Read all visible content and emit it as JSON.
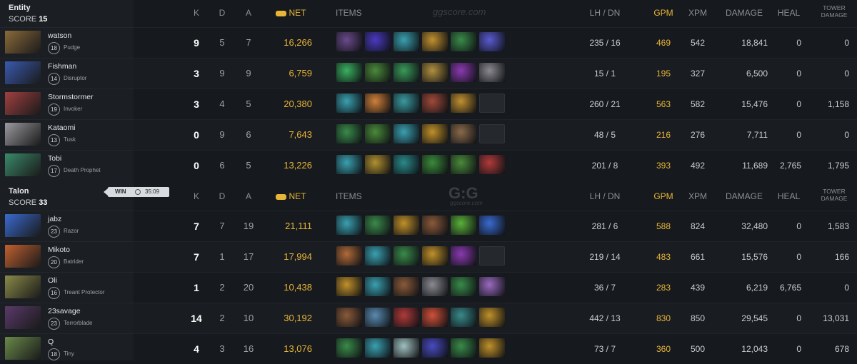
{
  "teams": [
    {
      "name": "Entity",
      "score_label": "SCORE",
      "score": "15",
      "players": [
        {
          "name": "watson",
          "level": "18",
          "hero": "Pudge",
          "k": "9",
          "d": "5",
          "a": "7",
          "net": "16,266",
          "lh_dn": "235 / 16",
          "gpm": "469",
          "xpm": "542",
          "damage": "18,841",
          "heal": "0",
          "tower": "0",
          "portrait": "#8a6a3a",
          "items": [
            "#6a4a8a",
            "#4a3ac0",
            "#3aa0b0",
            "#c09030",
            "#3a8a4a",
            "#5a5ad0"
          ]
        },
        {
          "name": "Fishman",
          "level": "14",
          "hero": "Disruptor",
          "k": "3",
          "d": "9",
          "a": "9",
          "net": "6,759",
          "lh_dn": "15 / 1",
          "gpm": "195",
          "xpm": "327",
          "damage": "6,500",
          "heal": "0",
          "tower": "0",
          "portrait": "#3a5ab0",
          "items": [
            "#3ab060",
            "#4a8a3a",
            "#3a9a5a",
            "#b09040",
            "#8a3ab0",
            "#8a8a90"
          ]
        },
        {
          "name": "Stormstormer",
          "level": "19",
          "hero": "Invoker",
          "k": "3",
          "d": "4",
          "a": "5",
          "net": "20,380",
          "lh_dn": "260 / 21",
          "gpm": "563",
          "xpm": "582",
          "damage": "15,476",
          "heal": "0",
          "tower": "1,158",
          "portrait": "#a04040",
          "items": [
            "#3aa0b0",
            "#d0803a",
            "#3a9aa0",
            "#a04a3a",
            "#c09030",
            "EMPTY"
          ]
        },
        {
          "name": "Kataomi",
          "level": "13",
          "hero": "Tusk",
          "k": "0",
          "d": "9",
          "a": "6",
          "net": "7,643",
          "lh_dn": "48 / 5",
          "gpm": "216",
          "xpm": "276",
          "damage": "7,711",
          "heal": "0",
          "tower": "0",
          "portrait": "#9a9aa0",
          "items": [
            "#3a8a4a",
            "#4a8a3a",
            "#3aa0b0",
            "#c0902a",
            "#8a6a4a",
            "EMPTY"
          ]
        },
        {
          "name": "Tobi",
          "level": "17",
          "hero": "Death Prophet",
          "k": "0",
          "d": "6",
          "a": "5",
          "net": "13,226",
          "lh_dn": "201 / 8",
          "gpm": "393",
          "xpm": "492",
          "damage": "11,689",
          "heal": "2,765",
          "tower": "1,795",
          "portrait": "#3a8a6a",
          "items": [
            "#3aa0b0",
            "#b09030",
            "#2a8a8a",
            "#3a8a3a",
            "#4a8a3a",
            "#b03a3a"
          ]
        }
      ]
    },
    {
      "name": "Talon",
      "score_label": "SCORE",
      "score": "33",
      "players": [
        {
          "name": "jabz",
          "level": "23",
          "hero": "Razor",
          "k": "7",
          "d": "7",
          "a": "19",
          "net": "21,111",
          "lh_dn": "281 / 6",
          "gpm": "588",
          "xpm": "824",
          "damage": "32,480",
          "heal": "0",
          "tower": "1,583",
          "portrait": "#3a6ad0",
          "items": [
            "#3aa0b0",
            "#3a8a4a",
            "#c0902a",
            "#8a5a3a",
            "#5ab03a",
            "#3a6ad0"
          ]
        },
        {
          "name": "Mikoto",
          "level": "20",
          "hero": "Batrider",
          "k": "7",
          "d": "1",
          "a": "17",
          "net": "17,994",
          "lh_dn": "219 / 14",
          "gpm": "483",
          "xpm": "661",
          "damage": "15,576",
          "heal": "0",
          "tower": "166",
          "portrait": "#c06030",
          "items": [
            "#b06a3a",
            "#3aa0b0",
            "#3a8a4a",
            "#c0902a",
            "#8a3ab0",
            "EMPTY"
          ]
        },
        {
          "name": "Oli",
          "level": "16",
          "hero": "Treant Protector",
          "k": "1",
          "d": "2",
          "a": "20",
          "net": "10,438",
          "lh_dn": "36 / 7",
          "gpm": "283",
          "xpm": "439",
          "damage": "6,219",
          "heal": "6,765",
          "tower": "0",
          "portrait": "#8a8a4a",
          "items": [
            "#c0902a",
            "#3aa0b0",
            "#8a5a3a",
            "#8a8a90",
            "#3a8a4a",
            "#9a6ac0"
          ]
        },
        {
          "name": "23savage",
          "level": "23",
          "hero": "Terrorblade",
          "k": "14",
          "d": "2",
          "a": "10",
          "net": "30,192",
          "lh_dn": "442 / 13",
          "gpm": "830",
          "xpm": "850",
          "damage": "29,545",
          "heal": "0",
          "tower": "13,031",
          "portrait": "#5a3a6a",
          "items": [
            "#8a5a3a",
            "#5a8ab0",
            "#b03a3a",
            "#d0503a",
            "#3a8a8a",
            "#c0902a"
          ]
        },
        {
          "name": "Q",
          "level": "18",
          "hero": "Tiny",
          "k": "4",
          "d": "3",
          "a": "16",
          "net": "13,076",
          "lh_dn": "73 / 7",
          "gpm": "360",
          "xpm": "500",
          "damage": "12,043",
          "heal": "0",
          "tower": "678",
          "portrait": "#6a8a4a",
          "items": [
            "#3a8a4a",
            "#3aa0b0",
            "#a0c0c0",
            "#4a4ac0",
            "#3a8a4a",
            "#c0902a"
          ]
        }
      ]
    }
  ],
  "headers": {
    "k": "K",
    "d": "D",
    "a": "A",
    "net": "NET",
    "items": "ITEMS",
    "lh_dn": "LH / DN",
    "gpm": "GPM",
    "xpm": "XPM",
    "damage": "DAMAGE",
    "heal": "HEAL",
    "tower": "TOWER DAMAGE"
  },
  "watermark_top": "ggscore.com",
  "watermark_mid": "G:G",
  "watermark_mid_small": "ggscore.com",
  "win_badge": {
    "label": "WIN",
    "time": "35:09"
  },
  "colors": {
    "gold": "#e8b538",
    "bg": "#16191d",
    "sidebar": "#1b1e22"
  }
}
